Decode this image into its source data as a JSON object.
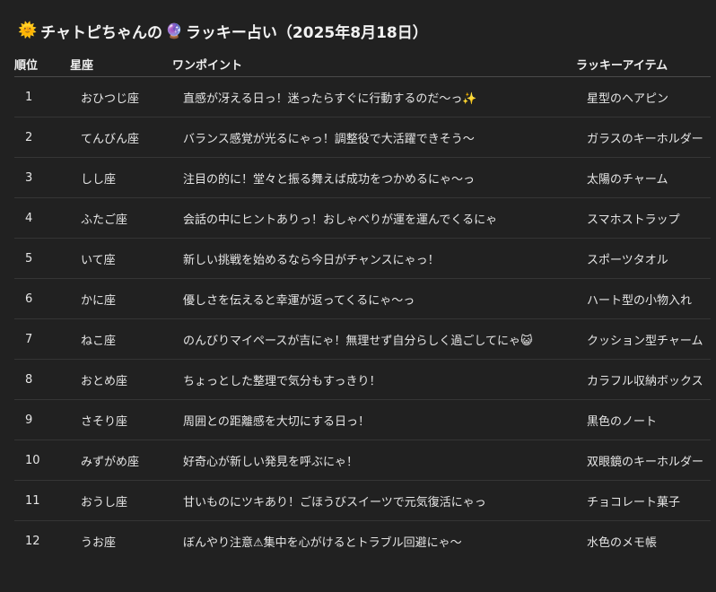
{
  "title": {
    "sun_icon": "🌞",
    "text_before": "チャトピちゃんの",
    "ball_icon": "🔮",
    "text_after": "ラッキー占い（2025年8月18日）"
  },
  "table": {
    "headers": [
      "順位",
      "星座",
      "ワンポイント",
      "ラッキーアイテム"
    ],
    "rows": [
      {
        "rank": "1",
        "sign": "おひつじ座",
        "point": "直感が冴える日っ！迷ったらすぐに行動するのだ〜っ✨",
        "item": "星型のヘアピン"
      },
      {
        "rank": "2",
        "sign": "てんびん座",
        "point": "バランス感覚が光るにゃっ！調整役で大活躍できそう〜",
        "item": "ガラスのキーホルダー"
      },
      {
        "rank": "3",
        "sign": "しし座",
        "point": "注目の的に！堂々と振る舞えば成功をつかめるにゃ〜っ",
        "item": "太陽のチャーム"
      },
      {
        "rank": "4",
        "sign": "ふたご座",
        "point": "会話の中にヒントありっ！おしゃべりが運を運んでくるにゃ",
        "item": "スマホストラップ"
      },
      {
        "rank": "5",
        "sign": "いて座",
        "point": "新しい挑戦を始めるなら今日がチャンスにゃっ！",
        "item": "スポーツタオル"
      },
      {
        "rank": "6",
        "sign": "かに座",
        "point": "優しさを伝えると幸運が返ってくるにゃ〜っ",
        "item": "ハート型の小物入れ"
      },
      {
        "rank": "7",
        "sign": "ねこ座",
        "point": "のんびりマイペースが吉にゃ！無理せず自分らしく過ごしてにゃ😺",
        "item": "クッション型チャーム"
      },
      {
        "rank": "8",
        "sign": "おとめ座",
        "point": "ちょっとした整理で気分もすっきり！",
        "item": "カラフル収納ボックス"
      },
      {
        "rank": "9",
        "sign": "さそり座",
        "point": "周囲との距離感を大切にする日っ！",
        "item": "黒色のノート"
      },
      {
        "rank": "10",
        "sign": "みずがめ座",
        "point": "好奇心が新しい発見を呼ぶにゃ！",
        "item": "双眼鏡のキーホルダー"
      },
      {
        "rank": "11",
        "sign": "おうし座",
        "point": "甘いものにツキあり！ごほうびスイーツで元気復活にゃっ",
        "item": "チョコレート菓子"
      },
      {
        "rank": "12",
        "sign": "うお座",
        "point": "ぼんやり注意⚠集中を心がけるとトラブル回避にゃ〜",
        "item": "水色のメモ帳"
      }
    ]
  }
}
